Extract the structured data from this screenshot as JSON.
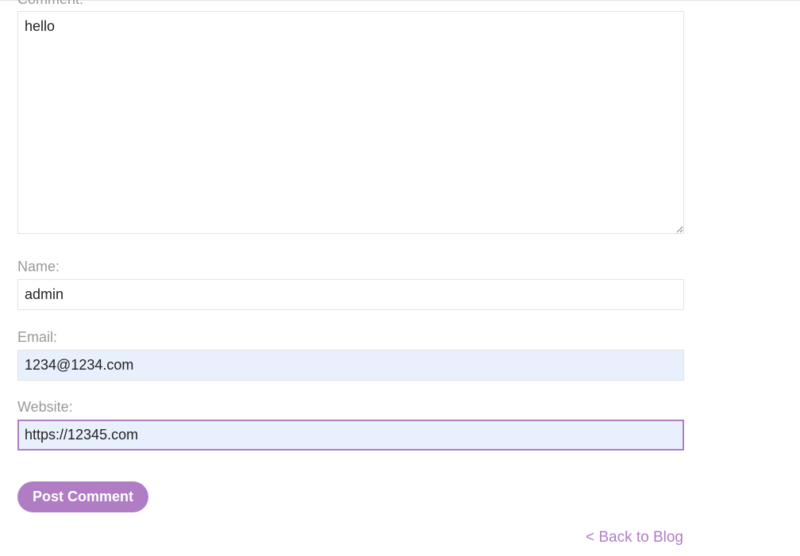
{
  "comment_form": {
    "comment": {
      "label": "Comment:",
      "value": "hello"
    },
    "name": {
      "label": "Name:",
      "value": "admin"
    },
    "email": {
      "label": "Email:",
      "value": "1234@1234.com"
    },
    "website": {
      "label": "Website:",
      "value": "https://12345.com"
    },
    "submit_label": "Post Comment"
  },
  "back_link": {
    "label": "< Back to Blog"
  },
  "colors": {
    "accent": "#b07dc5",
    "autofill_bg": "#e8f0fe",
    "label_gray": "#999999",
    "border": "#e3e3e3"
  }
}
